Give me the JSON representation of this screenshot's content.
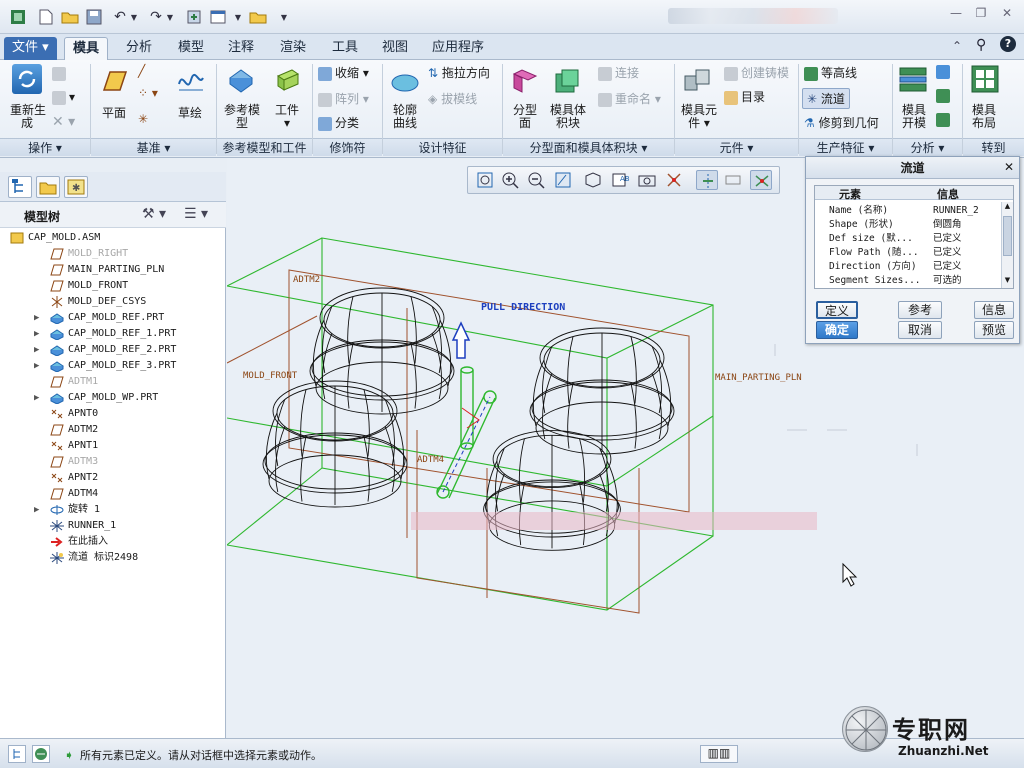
{
  "quick_access": {
    "icons": [
      "app-icon",
      "new-icon",
      "open-icon",
      "save-icon",
      "undo-icon",
      "redo-icon",
      "regenerate-icon",
      "window-icon",
      "folder-icon",
      "more-icon"
    ]
  },
  "menu_tabs": [
    "文件",
    "模具",
    "分析",
    "模型",
    "注释",
    "渲染",
    "工具",
    "视图",
    "应用程序"
  ],
  "ribbon": {
    "regen_label": "重新生\n成",
    "plane_label": "平面",
    "sketch_label": "草绘",
    "ref_model_label": "参考模\n型",
    "workpiece_label": "工件",
    "shrink_label": "收缩",
    "pattern_label": "阵列",
    "classify_label": "分类",
    "contour_label": "轮廓\n曲线",
    "drag_dir_label": "拖拉方向",
    "draft_check_label": "拔模线",
    "parting_surface_label": "分型\n面",
    "mold_volume_label": "模具体\n积块",
    "connect_label": "连接",
    "rename_label": "重命名",
    "mold_component_label": "模具元\n件",
    "create_casting_label": "创建铸模",
    "catalog_label": "目录",
    "contour_lines_label": "等高线",
    "runner_label": "流道",
    "trim_geometry_label": "修剪到几何",
    "mold_open_label": "模具\n开模",
    "mold_layout_label": "模具\n布局",
    "groups": {
      "operations": "操作",
      "datum": "基准",
      "ref_model_workpiece": "参考模型和工件",
      "modifiers": "修饰符",
      "design_features": "设计特征",
      "parting_volume": "分型面和模具体积块",
      "components": "元件",
      "production_features": "生产特征",
      "analysis": "分析",
      "goto": "转到"
    }
  },
  "model_tree": {
    "title": "模型树",
    "items": [
      {
        "label": "CAP_MOLD.ASM",
        "icon": "assembly-icon",
        "dim": false,
        "expand": false,
        "indent": 0
      },
      {
        "label": "MOLD_RIGHT",
        "icon": "datum-plane-icon",
        "dim": true,
        "expand": false,
        "indent": 1
      },
      {
        "label": "MAIN_PARTING_PLN",
        "icon": "datum-plane-icon",
        "dim": false,
        "expand": false,
        "indent": 1
      },
      {
        "label": "MOLD_FRONT",
        "icon": "datum-plane-icon",
        "dim": false,
        "expand": false,
        "indent": 1
      },
      {
        "label": "MOLD_DEF_CSYS",
        "icon": "csys-icon",
        "dim": false,
        "expand": false,
        "indent": 1
      },
      {
        "label": "CAP_MOLD_REF.PRT",
        "icon": "part-icon",
        "dim": false,
        "expand": true,
        "indent": 1
      },
      {
        "label": "CAP_MOLD_REF_1.PRT",
        "icon": "part-icon",
        "dim": false,
        "expand": true,
        "indent": 1
      },
      {
        "label": "CAP_MOLD_REF_2.PRT",
        "icon": "part-icon",
        "dim": false,
        "expand": true,
        "indent": 1
      },
      {
        "label": "CAP_MOLD_REF_3.PRT",
        "icon": "part-icon",
        "dim": false,
        "expand": true,
        "indent": 1
      },
      {
        "label": "ADTM1",
        "icon": "datum-plane-icon",
        "dim": true,
        "expand": false,
        "indent": 1
      },
      {
        "label": "CAP_MOLD_WP.PRT",
        "icon": "part-icon",
        "dim": false,
        "expand": true,
        "indent": 1
      },
      {
        "label": "APNT0",
        "icon": "datum-point-icon",
        "dim": false,
        "expand": false,
        "indent": 1
      },
      {
        "label": "ADTM2",
        "icon": "datum-plane-icon",
        "dim": false,
        "expand": false,
        "indent": 1
      },
      {
        "label": "APNT1",
        "icon": "datum-point-icon",
        "dim": false,
        "expand": false,
        "indent": 1
      },
      {
        "label": "ADTM3",
        "icon": "datum-plane-icon",
        "dim": true,
        "expand": false,
        "indent": 1
      },
      {
        "label": "APNT2",
        "icon": "datum-point-icon",
        "dim": false,
        "expand": false,
        "indent": 1
      },
      {
        "label": "ADTM4",
        "icon": "datum-plane-icon",
        "dim": false,
        "expand": false,
        "indent": 1
      },
      {
        "label": "旋转 1",
        "icon": "revolve-icon",
        "dim": false,
        "expand": true,
        "indent": 1
      },
      {
        "label": "RUNNER_1",
        "icon": "runner-icon",
        "dim": false,
        "expand": false,
        "indent": 1
      },
      {
        "label": "在此插入",
        "icon": "insert-arrow-icon",
        "dim": false,
        "expand": false,
        "indent": 1
      },
      {
        "label": "流道 标识2498",
        "icon": "runner-new-icon",
        "dim": false,
        "expand": false,
        "indent": 1
      }
    ]
  },
  "viewport": {
    "labels": {
      "pull_direction": "PULL DIRECTION",
      "adtm2": "ADTM2",
      "mold_front": "MOLD_FRONT",
      "main_parting_pln": "MAIN_PARTING_PLN",
      "adtm4": "ADTM4"
    }
  },
  "dialog": {
    "title": "流道",
    "col_element": "元素",
    "col_info": "信息",
    "rows": [
      {
        "element": "Name (名称)",
        "info": "RUNNER_2"
      },
      {
        "element": "Shape (形状)",
        "info": "倒圆角"
      },
      {
        "element": "Def size (默...",
        "info": "已定义"
      },
      {
        "element": "Flow Path (随...",
        "info": "已定义"
      },
      {
        "element": "Direction (方向)",
        "info": "已定义"
      },
      {
        "element": "Segment Sizes...",
        "info": "可选的"
      }
    ],
    "btn_define": "定义",
    "btn_reference": "参考",
    "btn_info": "信息",
    "btn_ok": "确定",
    "btn_cancel": "取消",
    "btn_preview": "预览"
  },
  "status": {
    "message": "所有元素已定义。请从对话框中选择元素或动作。"
  },
  "watermark": {
    "text_cn": "专职网",
    "text_en": "Zhuanzhi.Net"
  },
  "colors": {
    "accent": "#3b6eb3",
    "datum_green": "#2fb82f",
    "datum_brown": "#8b4513",
    "pull_blue": "#1d3fbf"
  }
}
